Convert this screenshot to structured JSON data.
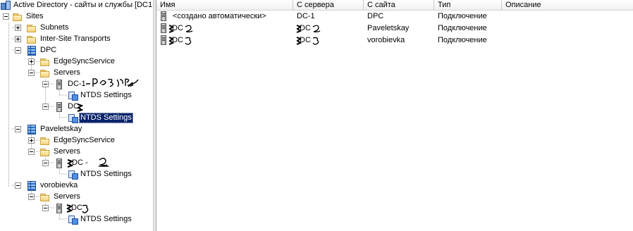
{
  "tree": {
    "root_label": "Active Directory - сайты и службы [DC1",
    "nodes": [
      {
        "label": "Sites"
      },
      {
        "label": "Subnets"
      },
      {
        "label": "Inter-Site Transports"
      },
      {
        "label": "DPC"
      },
      {
        "label": "EdgeSyncService"
      },
      {
        "label": "Servers"
      },
      {
        "label": "DC-1"
      },
      {
        "label": "NTDS Settings"
      },
      {
        "label": "DC"
      },
      {
        "label": "NTDS Settings"
      },
      {
        "label": "Paveletskay"
      },
      {
        "label": "EdgeSyncService"
      },
      {
        "label": "Servers"
      },
      {
        "label": "DC -"
      },
      {
        "label": "NTDS Settings"
      },
      {
        "label": "vorobievka"
      },
      {
        "label": "Servers"
      },
      {
        "label": "DC"
      },
      {
        "label": "NTDS Settings"
      }
    ]
  },
  "list": {
    "columns": [
      "Имя",
      "С сервера",
      "С сайта",
      "Тип",
      "Описание"
    ],
    "rows": [
      {
        "name": "<создано автоматически>",
        "from_server": "DC-1",
        "from_site": "DPC",
        "type": "Подключение",
        "description": ""
      },
      {
        "name": "DC",
        "from_server": "DC",
        "from_site": "Paveletskay",
        "type": "Подключение",
        "description": ""
      },
      {
        "name": "DC",
        "from_server": "DC",
        "from_site": "vorobievka",
        "type": "Подключение",
        "description": ""
      }
    ]
  },
  "colors": {
    "selection": "#0a246a",
    "site_icon": "#2f6fc9",
    "folder_icon": "#f4d27c"
  }
}
